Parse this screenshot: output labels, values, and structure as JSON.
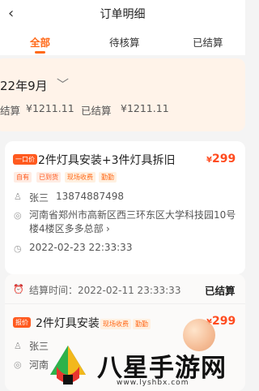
{
  "header": {
    "back_icon": "‹",
    "title": "订单明细"
  },
  "tabs": [
    {
      "label": "全部",
      "active": true
    },
    {
      "label": "待核算",
      "active": false
    },
    {
      "label": "已结算",
      "active": false
    }
  ],
  "summary": {
    "month": "22年9月",
    "chevron_icon": "chevron-down-icon",
    "pending_label": "结算",
    "pending_amount": "¥1211.11",
    "settled_label": "已结算",
    "settled_amount": "¥1211.11"
  },
  "orders": [
    {
      "badge": "一口价",
      "title": "2件灯具安装+3件灯具拆旧",
      "price": "299",
      "price_prefix": "¥",
      "tags": [
        "自有",
        "已到货",
        "现场收费",
        "勤勤"
      ],
      "name": "张三",
      "phone": "13874887498",
      "address_line1": "河南省郑州市高新区西三环东区大学科技园10号",
      "address_line2": "楼4楼区多多总部",
      "address_arrow": "›",
      "time": "2022-02-23 22:33:33"
    },
    {
      "settle_time_label": "结算时间：2022-02-11 23:33:33",
      "status": "已结算",
      "badge": "报价",
      "title": "2件灯具安装",
      "price": "299",
      "price_prefix": "¥",
      "tags": [
        "现场收费",
        "勤勤"
      ],
      "name": "张三",
      "address_fragment": "河南"
    }
  ],
  "watermark": {
    "text": "八星手游网",
    "url": "www.lyshbx.com"
  },
  "colors": {
    "accent": "#ff6a1a",
    "price": "#ff4b1f",
    "summary_bg": "#fff3e9"
  }
}
